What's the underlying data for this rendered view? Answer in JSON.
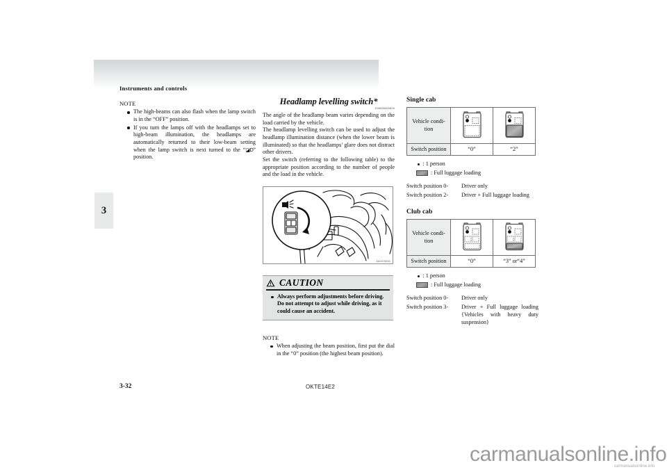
{
  "running_head": "Instruments and controls",
  "chapter_tab": "3",
  "left_column": {
    "note_label": "NOTE",
    "bullets": [
      "The high-beams can also flash when the lamp switch is in the “OFF” position.",
      "If you turn the lamps off with the headlamps set to high-beam illumination, the headlamps are automatically returned to their low-beam setting when the lamp switch is next turned to the “ ” position."
    ],
    "bullet2_prefix": "If you turn the lamps off with the headlamps set to high-beam illumination, the headlamps are automatically returned to their low-beam setting when the lamp switch is next turned to the “",
    "bullet2_suffix": "” position.",
    "lowbeam_icon": "low-beam-headlamp-symbol"
  },
  "middle_column": {
    "title": "Headlamp levelling switch*",
    "doc_code": "E00506400826",
    "paragraphs": [
      "The angle of the headlamp beam varies depending on the load carried by the vehicle.",
      "The headlamp levelling switch can be used to adjust the headlamp illumination distance (when the lower beam is illuminated) so that the headlamps’ glare does not distract other drivers.",
      "Set the switch (referring to the following table) to the appropriate position according to the number of people and the load in the vehicle."
    ],
    "figure_code": "AA0078953",
    "figure_name": "headlamp-levelling-dial-illustration",
    "caution": {
      "title": "CAUTION",
      "icon": "warning-triangle-icon",
      "bullets": [
        "Always perform adjustments before driving.",
        "Do not attempt to adjust while driving, as it could cause an accident."
      ]
    },
    "note_bottom": {
      "label": "NOTE",
      "bullets": [
        "When adjusting the beam position, first put the dial in the “0” position (the highest beam position)."
      ]
    }
  },
  "right_column": {
    "single_cab": {
      "heading": "Single cab",
      "row_labels": [
        "Vehicle condi-tion",
        "Switch position"
      ],
      "row_label_condition": "Vehicle condi-\ntion",
      "row_label_position": "Switch position",
      "columns": [
        {
          "icon": "single-cab-driver-only-icon",
          "switch_position": "“0”"
        },
        {
          "icon": "single-cab-full-load-icon",
          "switch_position": "“2”"
        }
      ],
      "legend": [
        {
          "symbol": "person-dot",
          "text": ": 1 person"
        },
        {
          "symbol": "luggage-swatch",
          "text": ": Full luggage loading"
        }
      ],
      "positions": [
        {
          "key": "Switch position 0-",
          "value": "Driver only"
        },
        {
          "key": "Switch position 2-",
          "value": "Driver + Full luggage loading"
        }
      ]
    },
    "club_cab": {
      "heading": "Club cab",
      "row_label_condition": "Vehicle condi-\ntion",
      "row_label_position": "Switch position",
      "columns": [
        {
          "icon": "club-cab-driver-only-icon",
          "switch_position": "“0”"
        },
        {
          "icon": "club-cab-full-load-icon",
          "switch_position": "“3” or“4”"
        }
      ],
      "legend": [
        {
          "symbol": "person-dot",
          "text": ": 1 person"
        },
        {
          "symbol": "luggage-swatch",
          "text": ": Full luggage loading"
        }
      ],
      "positions": [
        {
          "key": "Switch position 0-",
          "value": "Driver only"
        },
        {
          "key": "Switch position 3-",
          "value": "Driver + Full luggage loading {Vehicles with heavy duty suspension}"
        }
      ]
    }
  },
  "footer": {
    "page_number": "3-32",
    "doc_code": "OKTE14E2"
  },
  "watermark": {
    "main": "carmanualsonline.info",
    "sub": "carmanualsonline.info"
  }
}
